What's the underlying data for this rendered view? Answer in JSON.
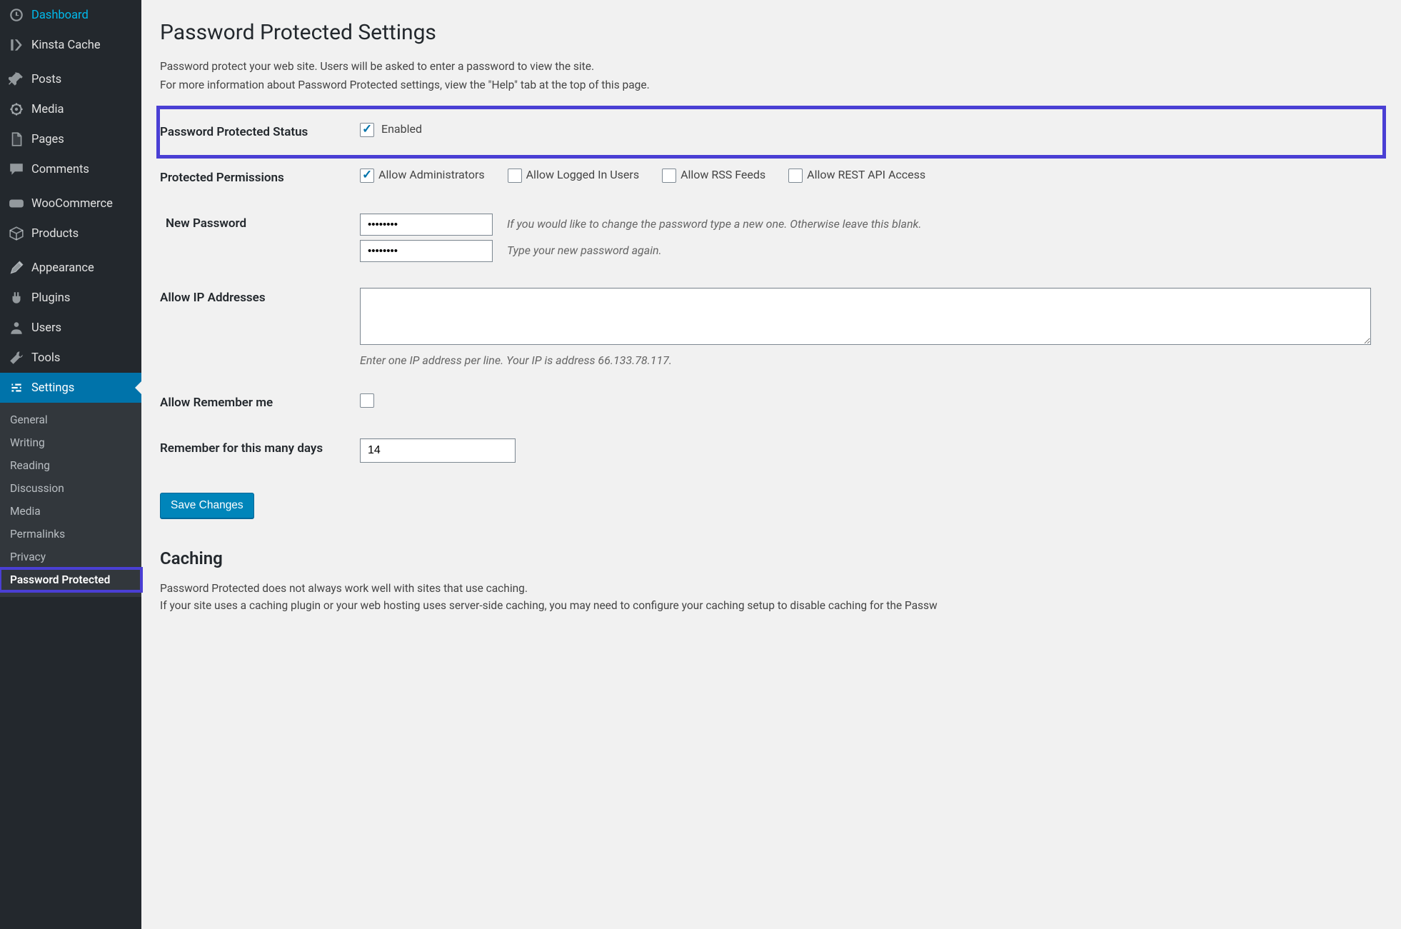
{
  "sidebar": {
    "items": [
      {
        "label": "Dashboard",
        "icon": "dashboard"
      },
      {
        "label": "Kinsta Cache",
        "icon": "kinsta"
      },
      {
        "label": "Posts",
        "icon": "pin"
      },
      {
        "label": "Media",
        "icon": "media"
      },
      {
        "label": "Pages",
        "icon": "page"
      },
      {
        "label": "Comments",
        "icon": "comment"
      },
      {
        "label": "WooCommerce",
        "icon": "woo"
      },
      {
        "label": "Products",
        "icon": "products"
      },
      {
        "label": "Appearance",
        "icon": "appearance"
      },
      {
        "label": "Plugins",
        "icon": "plugins"
      },
      {
        "label": "Users",
        "icon": "users"
      },
      {
        "label": "Tools",
        "icon": "tools"
      },
      {
        "label": "Settings",
        "icon": "settings",
        "active": true
      }
    ],
    "submenu": [
      "General",
      "Writing",
      "Reading",
      "Discussion",
      "Media",
      "Permalinks",
      "Privacy",
      "Password Protected"
    ],
    "submenu_current": "Password Protected"
  },
  "page": {
    "title": "Password Protected Settings",
    "desc1": "Password protect your web site. Users will be asked to enter a password to view the site.",
    "desc2": "For more information about Password Protected settings, view the \"Help\" tab at the top of this page."
  },
  "fields": {
    "status_label": "Password Protected Status",
    "status_cb": "Enabled",
    "perm_label": "Protected Permissions",
    "perm_admin": "Allow Administrators",
    "perm_logged": "Allow Logged In Users",
    "perm_rss": "Allow RSS Feeds",
    "perm_rest": "Allow REST API Access",
    "newpw_label": "New Password",
    "newpw_help1": "If you would like to change the password type a new one. Otherwise leave this blank.",
    "newpw_help2": "Type your new password again.",
    "ip_label": "Allow IP Addresses",
    "ip_desc": "Enter one IP address per line. Your IP is address 66.133.78.117.",
    "remember_label": "Allow Remember me",
    "days_label": "Remember for this many days",
    "days_value": "14",
    "save": "Save Changes"
  },
  "caching": {
    "title": "Caching",
    "p1": "Password Protected does not always work well with sites that use caching.",
    "p2": "If your site uses a caching plugin or your web hosting uses server-side caching, you may need to configure your caching setup to disable caching for the Passw"
  }
}
